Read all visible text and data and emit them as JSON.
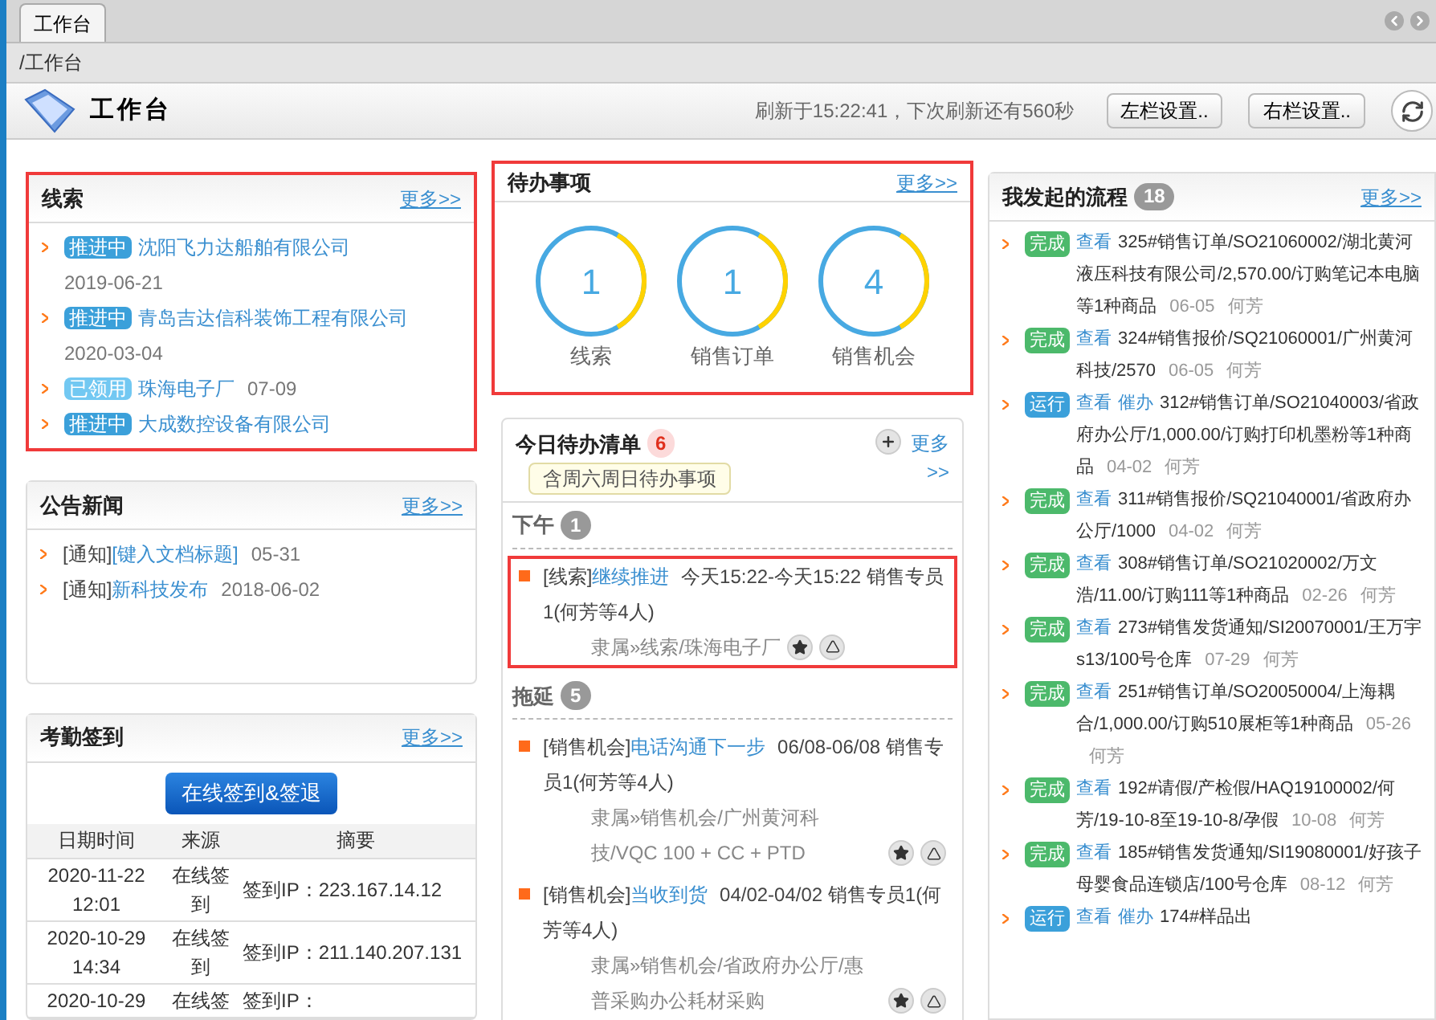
{
  "tabs": [
    {
      "label": "工作台",
      "selected": true
    }
  ],
  "breadcrumb": "/工作台",
  "header": {
    "title": "工作台",
    "refresh_text": "刷新于15:22:41，下次刷新还有560秒",
    "buttons": [
      "左栏设置..",
      "右栏设置.."
    ]
  },
  "leads": {
    "title": "线索",
    "more": "更多>>",
    "highlighted": true,
    "items": [
      {
        "status": "推进中",
        "kind": "progress",
        "name": "沈阳飞力达船舶有限公司",
        "date": "2019-06-21"
      },
      {
        "status": "推进中",
        "kind": "progress",
        "name": "青岛吉达信科装饰工程有限公司",
        "date": "2020-03-04"
      },
      {
        "status": "已领用",
        "kind": "claimed",
        "name": "珠海电子厂",
        "date": "07-09"
      },
      {
        "status": "推进中",
        "kind": "progress",
        "name": "大成数控设备有限公司"
      }
    ]
  },
  "news": {
    "title": "公告新闻",
    "more": "更多>>",
    "items": [
      {
        "tag": "[通知]",
        "title": "[键入文档标题]",
        "date": "05-31"
      },
      {
        "tag": "[通知]",
        "title": "新科技发布",
        "date": "2018-06-02"
      }
    ]
  },
  "attendance": {
    "title": "考勤签到",
    "more": "更多>>",
    "button": "在线签到&签退",
    "columns": [
      "日期时间",
      "来源",
      "摘要"
    ],
    "rows": [
      [
        "2020-11-22 12:01",
        "在线签到",
        "签到IP：223.167.14.12"
      ],
      [
        "2020-10-29 14:34",
        "在线签到",
        "签到IP：211.140.207.131"
      ],
      [
        "2020-10-29",
        "在线签",
        "签到IP："
      ]
    ]
  },
  "todo": {
    "title": "待办事项",
    "more": "更多>>",
    "highlighted": true,
    "items": [
      {
        "count": "1",
        "label": "线索"
      },
      {
        "count": "1",
        "label": "销售订单"
      },
      {
        "count": "4",
        "label": "销售机会"
      }
    ]
  },
  "today": {
    "title": "今日待办清单",
    "count": "6",
    "note": "含周六周日待办事项",
    "more": "更多>>",
    "groups": [
      {
        "name": "下午",
        "count": "1",
        "items": [
          {
            "category": "[线索]",
            "title": "继续推进",
            "detail": "今天15:22-今天15:22 销售专员1(何芳等4人)",
            "belongs": "隶属»线索/珠海电子厂",
            "highlighted": true
          }
        ]
      },
      {
        "name": "拖延",
        "count": "5",
        "items": [
          {
            "category": "[销售机会]",
            "title": "电话沟通下一步",
            "detail": "06/08-06/08 销售专员1(何芳等4人)",
            "belongs": "隶属»销售机会/广州黄河科技/VQC 100 + CC + PTD",
            "highlighted": false
          },
          {
            "category": "[销售机会]",
            "title": "当收到货",
            "detail": "04/02-04/02 销售专员1(何芳等4人)",
            "belongs": "隶属»销售机会/省政府办公厅/惠普采购办公耗材采购",
            "highlighted": false
          }
        ]
      }
    ]
  },
  "processes": {
    "title": "我发起的流程",
    "count": "18",
    "more": "更多>>",
    "items": [
      {
        "status": "完成",
        "kind": "done",
        "actions": [
          "查看"
        ],
        "text": "325#销售订单/SO21060002/湖北黄河液压科技有限公司/2,570.00/订购笔记本电脑等1种商品",
        "date": "06-05",
        "person": "何芳"
      },
      {
        "status": "完成",
        "kind": "done",
        "actions": [
          "查看"
        ],
        "text": "324#销售报价/SQ21060001/广州黄河科技/2570",
        "date": "06-05",
        "person": "何芳"
      },
      {
        "status": "运行",
        "kind": "running",
        "actions": [
          "查看",
          "催办"
        ],
        "text": "312#销售订单/SO21040003/省政府办公厅/1,000.00/订购打印机墨粉等1种商品",
        "date": "04-02",
        "person": "何芳"
      },
      {
        "status": "完成",
        "kind": "done",
        "actions": [
          "查看"
        ],
        "text": "311#销售报价/SQ21040001/省政府办公厅/1000",
        "date": "04-02",
        "person": "何芳"
      },
      {
        "status": "完成",
        "kind": "done",
        "actions": [
          "查看"
        ],
        "text": "308#销售订单/SO21020002/万文浩/11.00/订购111等1种商品",
        "date": "02-26",
        "person": "何芳"
      },
      {
        "status": "完成",
        "kind": "done",
        "actions": [
          "查看"
        ],
        "text": "273#销售发货通知/SI20070001/王万宇s13/100号仓库",
        "date": "07-29",
        "person": "何芳"
      },
      {
        "status": "完成",
        "kind": "done",
        "actions": [
          "查看"
        ],
        "text": "251#销售订单/SO20050004/上海耦合/1,000.00/订购510展柜等1种商品",
        "date": "05-26",
        "person": "何芳"
      },
      {
        "status": "完成",
        "kind": "done",
        "actions": [
          "查看"
        ],
        "text": "192#请假/产检假/HAQ19100002/何芳/19-10-8至19-10-8/孕假",
        "date": "10-08",
        "person": "何芳"
      },
      {
        "status": "完成",
        "kind": "done",
        "actions": [
          "查看"
        ],
        "text": "185#销售发货通知/SI19080001/好孩子母婴食品连锁店/100号仓库",
        "date": "08-12",
        "person": "何芳"
      },
      {
        "status": "运行",
        "kind": "running",
        "actions": [
          "查看",
          "催办"
        ],
        "text": "174#样品出"
      }
    ]
  }
}
